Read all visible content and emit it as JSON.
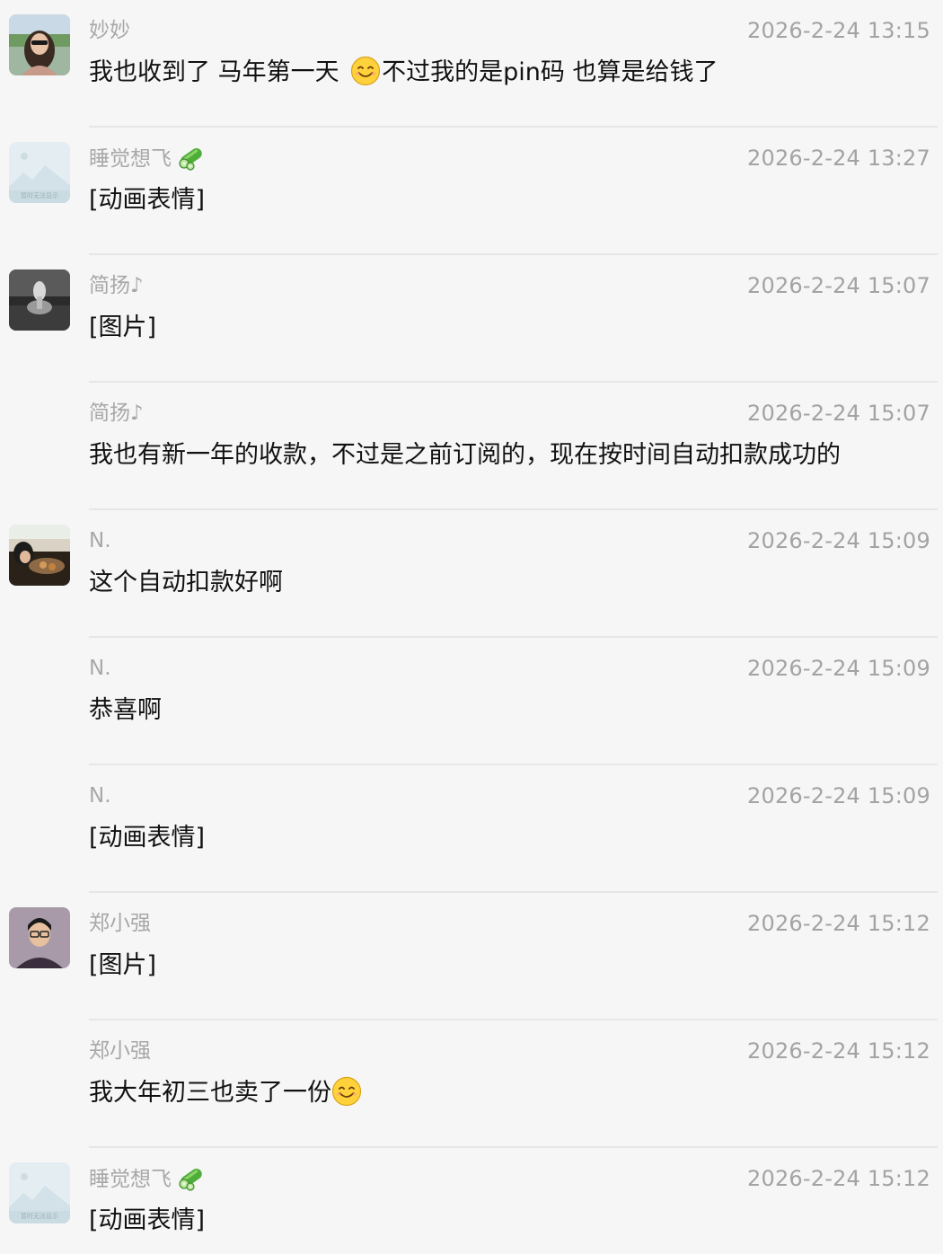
{
  "messages": [
    {
      "sender": "妙妙",
      "time": "2026-2-24 13:15",
      "text_before": "我也收到了 马年第一天 ",
      "text_after": "不过我的是pin码 也算是给钱了"
    },
    {
      "sender": "睡觉想飞",
      "time": "2026-2-24 13:27",
      "text": "[动画表情]"
    },
    {
      "sender": "简扬♪",
      "time": "2026-2-24 15:07",
      "text": "[图片]"
    },
    {
      "sender": "简扬♪",
      "time": "2026-2-24 15:07",
      "text": "我也有新一年的收款，不过是之前订阅的，现在按时间自动扣款成功的"
    },
    {
      "sender": "N.",
      "time": "2026-2-24 15:09",
      "text": "这个自动扣款好啊"
    },
    {
      "sender": "N.",
      "time": "2026-2-24 15:09",
      "text": "恭喜啊"
    },
    {
      "sender": "N.",
      "time": "2026-2-24 15:09",
      "text": "[动画表情]"
    },
    {
      "sender": "郑小强",
      "time": "2026-2-24 15:12",
      "text": "[图片]"
    },
    {
      "sender": "郑小强",
      "time": "2026-2-24 15:12",
      "text_before": "我大年初三也卖了一份",
      "text_after": ""
    },
    {
      "sender": "睡觉想飞",
      "time": "2026-2-24 15:12",
      "text": "[动画表情]"
    }
  ],
  "placeholder_avatar_caption": "暂时无法显示"
}
